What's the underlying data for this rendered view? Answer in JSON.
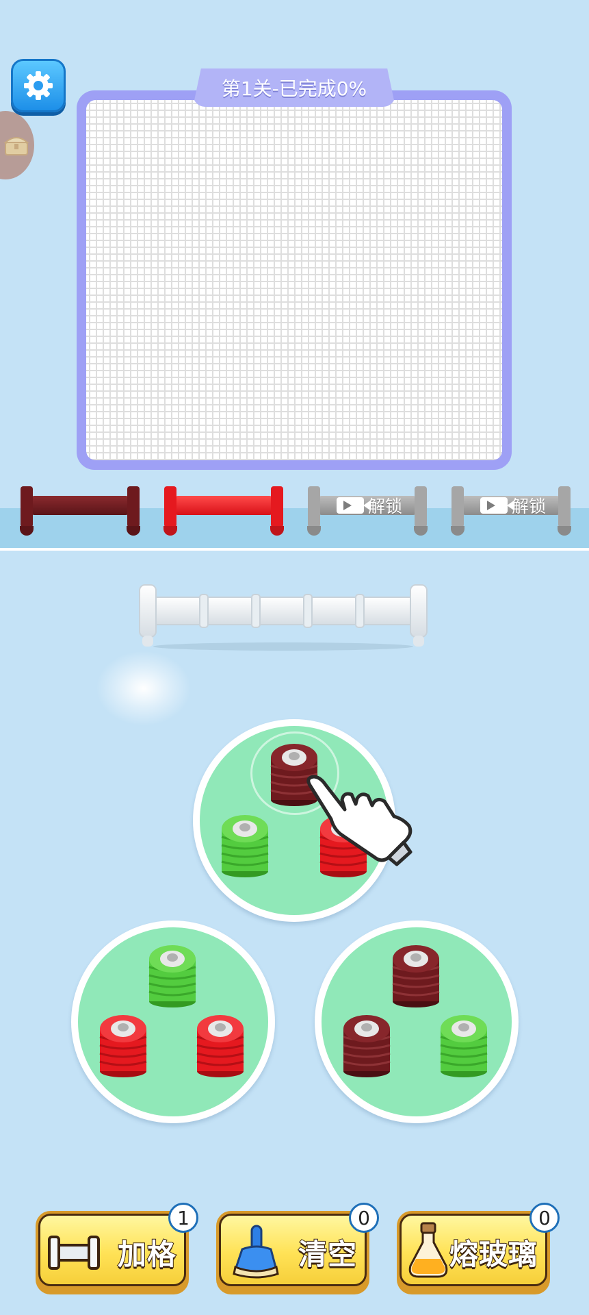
{
  "level_label": "第1关-已完成0%",
  "unlock_label": "解锁",
  "racks": [
    {
      "color": "#6e1a1e",
      "locked": false
    },
    {
      "color": "#e5191f",
      "locked": false
    },
    {
      "color": "#a6a6a6",
      "locked": true
    },
    {
      "color": "#a6a6a6",
      "locked": true
    }
  ],
  "colors": {
    "dark_red": "#6e1a1e",
    "red": "#e5191f",
    "green": "#53cc3f",
    "plate": "#90e8b8",
    "board_frame": "#9ea0f5"
  },
  "plates": [
    {
      "name": "top",
      "stacks": [
        "dark_red",
        "green",
        "red"
      ]
    },
    {
      "name": "bottom-left",
      "stacks": [
        "green",
        "red",
        "red"
      ]
    },
    {
      "name": "bottom-right",
      "stacks": [
        "dark_red",
        "dark_red",
        "green"
      ]
    }
  ],
  "buttons": [
    {
      "label": "加格",
      "count": "1",
      "icon": "rack-icon"
    },
    {
      "label": "清空",
      "count": "0",
      "icon": "broom-icon"
    },
    {
      "label": "熔玻璃",
      "count": "0",
      "icon": "potion-icon"
    }
  ]
}
